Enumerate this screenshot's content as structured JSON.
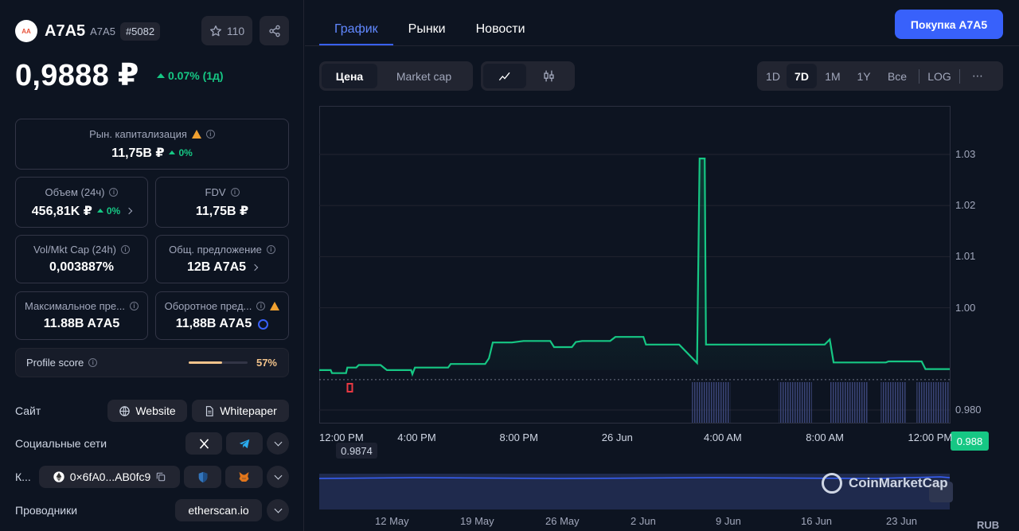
{
  "coin": {
    "logo_text": "AA",
    "name": "A7A5",
    "symbol": "A7A5",
    "rank": "#5082",
    "watchlist_count": "110",
    "price": "0,9888 ₽",
    "change": "0.07% (1д)"
  },
  "stats": {
    "market_cap": {
      "label": "Рын. капитализация",
      "value": "11,75B ₽",
      "change": "0%"
    },
    "volume": {
      "label": "Объем (24ч)",
      "value": "456,81K ₽",
      "change": "0%"
    },
    "fdv": {
      "label": "FDV",
      "value": "11,75B ₽"
    },
    "vol_mkt_cap": {
      "label": "Vol/Mkt Cap (24h)",
      "value": "0,003887%"
    },
    "total_supply": {
      "label": "Общ. предложение",
      "value": "12B A7A5"
    },
    "max_supply": {
      "label": "Максимальное пре...",
      "value": "11.88B A7A5"
    },
    "circulating_supply": {
      "label": "Оборотное пред...",
      "value": "11,88B A7A5"
    }
  },
  "profile": {
    "label": "Profile score",
    "value": "57%",
    "fraction": 0.57
  },
  "links": {
    "site_label": "Сайт",
    "website": "Website",
    "whitepaper": "Whitepaper",
    "social_label": "Социальные сети",
    "contract_label": "К...",
    "contract_address": "0×6fA0...AB0fc9",
    "explorers_label": "Проводники",
    "explorer": "etherscan.io"
  },
  "tabs": [
    {
      "label": "График",
      "active": true
    },
    {
      "label": "Рынки",
      "active": false
    },
    {
      "label": "Новости",
      "active": false
    }
  ],
  "buy_button": "Покупка A7A5",
  "chart_toggles": {
    "price": "Цена",
    "market_cap": "Market cap"
  },
  "ranges": [
    "1D",
    "7D",
    "1M",
    "1Y",
    "Все",
    "LOG",
    "⋯"
  ],
  "selected_range": "7D",
  "watermark": "CoinMarketCap",
  "start_price_label": "0.9874",
  "current_price_label": "0.988",
  "currency_label": "RUB",
  "colors": {
    "accent": "#3861fb",
    "up": "#16c784",
    "down": "#ea3943",
    "warning": "#f0a030",
    "profile": "#f2c38b"
  },
  "chart_data": {
    "type": "line",
    "yticks": [
      "1.03",
      "1.02",
      "1.01",
      "1.00",
      "0.980"
    ],
    "ylim": [
      0.9775,
      1.0395
    ],
    "xticks": [
      "12:00 PM",
      "4:00 PM",
      "8:00 PM",
      "26 Jun",
      "4:00 AM",
      "8:00 AM",
      "12:00 PM"
    ],
    "x_hours": [
      0,
      4,
      8,
      12,
      16,
      20,
      24
    ],
    "series": [
      {
        "points": [
          [
            0,
            0.9878
          ],
          [
            0.45,
            0.9878
          ],
          [
            0.5,
            0.9872
          ],
          [
            1.05,
            0.9872
          ],
          [
            1.1,
            0.9883
          ],
          [
            1.45,
            0.9883
          ],
          [
            1.55,
            0.9888
          ],
          [
            2.4,
            0.9888
          ],
          [
            2.65,
            0.9878
          ],
          [
            3.6,
            0.9878
          ],
          [
            3.65,
            0.987
          ],
          [
            3.75,
            0.9883
          ],
          [
            5.05,
            0.9883
          ],
          [
            5.15,
            0.989
          ],
          [
            6.5,
            0.989
          ],
          [
            6.65,
            0.9901
          ],
          [
            6.8,
            0.9932
          ],
          [
            7.55,
            0.9932
          ],
          [
            8.0,
            0.9935
          ],
          [
            9.05,
            0.9935
          ],
          [
            9.2,
            0.9923
          ],
          [
            9.9,
            0.9923
          ],
          [
            10.05,
            0.9933
          ],
          [
            10.3,
            0.9935
          ],
          [
            11.4,
            0.9935
          ],
          [
            11.6,
            0.9943
          ],
          [
            12.7,
            0.9943
          ],
          [
            12.8,
            0.9928
          ],
          [
            14.1,
            0.9928
          ],
          [
            14.8,
            0.9892
          ],
          [
            14.9,
            1.0292
          ],
          [
            15.1,
            1.0292
          ],
          [
            15.15,
            0.9928
          ],
          [
            19.8,
            0.9928
          ],
          [
            20.0,
            0.9938
          ],
          [
            20.15,
            0.9893
          ],
          [
            22.2,
            0.9893
          ],
          [
            22.3,
            0.9895
          ],
          [
            23.6,
            0.9895
          ],
          [
            23.75,
            0.988
          ],
          [
            24.7,
            0.988
          ]
        ]
      }
    ],
    "red_candle": {
      "x": 1.2,
      "top": 0.987,
      "bottom": 0.9855
    },
    "volume_bars": [
      {
        "from": 14.6,
        "to": 16.1
      },
      {
        "from": 18.0,
        "to": 19.3
      },
      {
        "from": 20.0,
        "to": 21.5
      },
      {
        "from": 22.0,
        "to": 23.0
      },
      {
        "from": 23.4,
        "to": 24.7
      }
    ],
    "navigator_ticks": [
      "12 May",
      "19 May",
      "26 May",
      "2 Jun",
      "9 Jun",
      "16 Jun",
      "23 Jun"
    ]
  }
}
